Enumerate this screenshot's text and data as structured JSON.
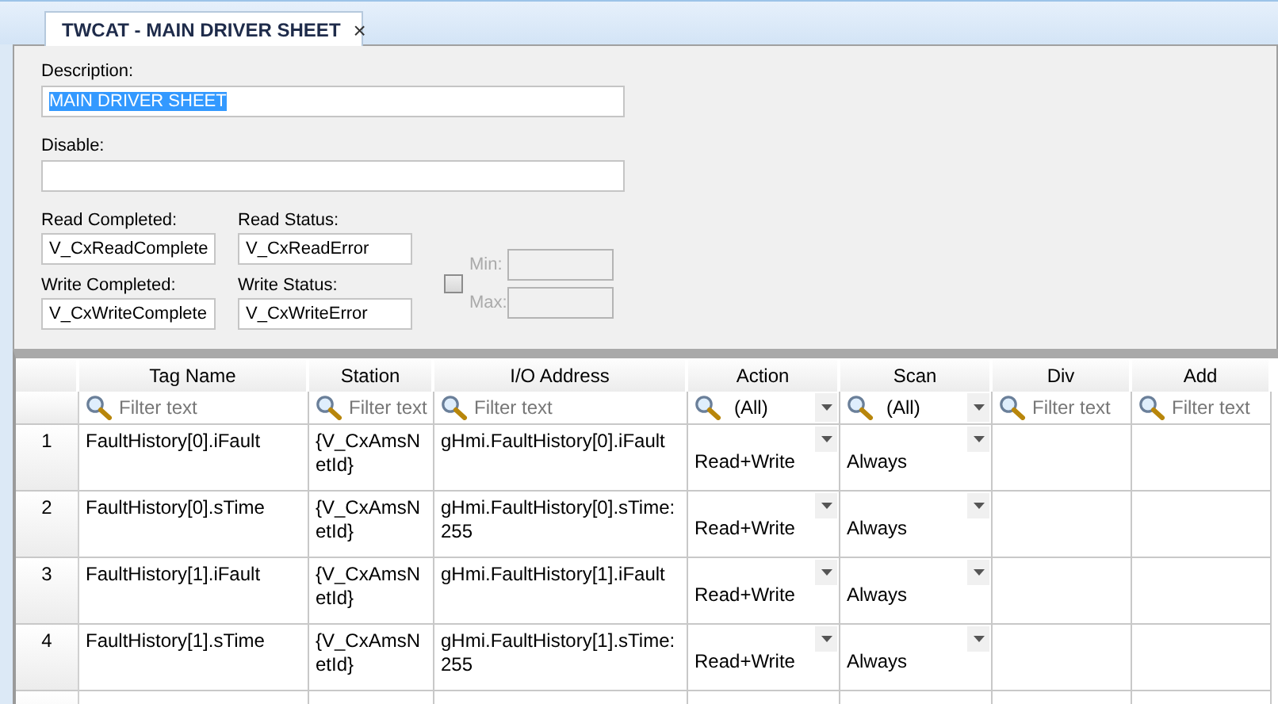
{
  "tab": {
    "title": "TWCAT - MAIN DRIVER SHEET",
    "close": "×"
  },
  "form": {
    "description": {
      "label": "Description:",
      "value": "MAIN DRIVER SHEET",
      "selected": true
    },
    "disable": {
      "label": "Disable:"
    },
    "fields": [
      {
        "label": "Read Completed:",
        "value": "V_CxReadComplete"
      },
      {
        "label": "Read Status:",
        "value": "V_CxReadError"
      },
      {
        "label": "Write Completed:",
        "value": "V_CxWriteComplete"
      },
      {
        "label": "Write Status:",
        "value": "V_CxWriteError"
      }
    ],
    "range": {
      "checked": false,
      "disabled": true,
      "min_label": "Min:",
      "max_label": "Max:"
    }
  },
  "table": {
    "columns": [
      "Tag Name",
      "Station",
      "I/O Address",
      "Action",
      "Scan",
      "Div",
      "Add"
    ],
    "filters": [
      {
        "kind": "text",
        "placeholder": "Filter text"
      },
      {
        "kind": "text",
        "placeholder": "Filter text"
      },
      {
        "kind": "text",
        "placeholder": "Filter text"
      },
      {
        "kind": "combo",
        "value": "(All)"
      },
      {
        "kind": "combo",
        "value": "(All)"
      },
      {
        "kind": "text",
        "placeholder": "Filter text"
      },
      {
        "kind": "text",
        "placeholder": "Filter text"
      }
    ],
    "rows": [
      {
        "number": "1",
        "tag_name": "FaultHistory[0].iFault",
        "station": "{V_CxAmsNetId}",
        "io_address": "gHmi.FaultHistory[0].iFault",
        "action": "Read+Write",
        "scan": "Always"
      },
      {
        "number": "2",
        "tag_name": "FaultHistory[0].sTime",
        "station": "{V_CxAmsNetId}",
        "io_address": "gHmi.FaultHistory[0].sTime:255",
        "action": "Read+Write",
        "scan": "Always"
      },
      {
        "number": "3",
        "tag_name": "FaultHistory[1].iFault",
        "station": "{V_CxAmsNetId}",
        "io_address": "gHmi.FaultHistory[1].iFault",
        "action": "Read+Write",
        "scan": "Always"
      },
      {
        "number": "4",
        "tag_name": "FaultHistory[1].sTime",
        "station": "{V_CxAmsNetId}",
        "io_address": "gHmi.FaultHistory[1].sTime:255",
        "action": "Read+Write",
        "scan": "Always"
      }
    ]
  }
}
